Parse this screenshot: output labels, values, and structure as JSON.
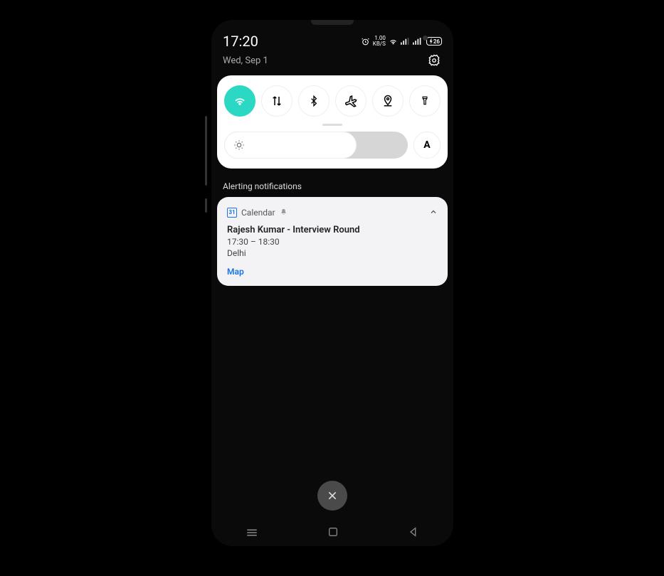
{
  "statusbar": {
    "time": "17:20",
    "network_speed_value": "1.00",
    "network_speed_unit": "KB/S",
    "battery_percent": "26"
  },
  "header": {
    "date": "Wed, Sep 1"
  },
  "quick_settings": {
    "brightness_percent": 72,
    "auto_label": "A"
  },
  "notifications": {
    "section_label": "Alerting notifications",
    "items": [
      {
        "app_icon_text": "31",
        "app_name": "Calendar",
        "title": "Rajesh Kumar - Interview Round",
        "time": "17:30 – 18:30",
        "location": "Delhi",
        "action": "Map"
      }
    ]
  }
}
